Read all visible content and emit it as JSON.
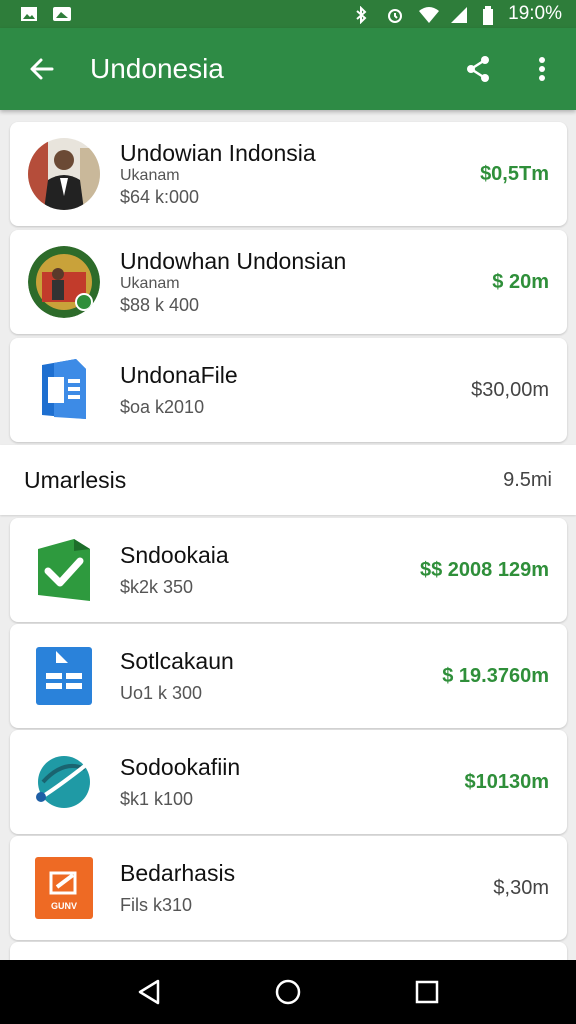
{
  "status_bar": {
    "time": "19:0%",
    "icons": [
      "image-icon",
      "photo-icon",
      "bluetooth-icon",
      "alarm-icon",
      "wifi-icon",
      "signal-icon",
      "battery-icon"
    ]
  },
  "app_bar": {
    "title": "Undonesia",
    "accent_color": "#2e8b45"
  },
  "items": [
    {
      "name": "Undowian Indonsia",
      "sub": "Ukanam",
      "meta": "$64 k:000",
      "price": "$0,5Tm",
      "price_color": "green",
      "thumb": "person-avatar"
    },
    {
      "name": "Undowhan Undonsian",
      "sub": "Ukanam",
      "meta": "$88 k 400",
      "price": "$ 20m",
      "price_color": "green",
      "thumb": "emblem-avatar"
    },
    {
      "name": "UndonaFile",
      "sub": "",
      "meta": "$oa k2010",
      "price": "$30,00m",
      "price_color": "gray",
      "thumb": "doc-app-icon"
    }
  ],
  "section": {
    "title": "Umarlesis",
    "count": "9.5mi"
  },
  "items2": [
    {
      "name": "Sndookaia",
      "meta": "$k2k 350",
      "price": "$$ 2008 129m",
      "price_color": "green",
      "thumb": "check-app-icon"
    },
    {
      "name": "Sotlcakaun",
      "meta": "Uo1 k 300",
      "price": "$ 19.3760m",
      "price_color": "green",
      "thumb": "sheet-app-icon"
    },
    {
      "name": "Sodookafiin",
      "meta": "$k1 k100",
      "price": "$10130m",
      "price_color": "green",
      "thumb": "planet-app-icon"
    },
    {
      "name": "Bedarhasis",
      "meta": "Fils k310",
      "price": "$,30m",
      "price_color": "gray",
      "thumb": "orange-app-icon",
      "thumb_text": "GUNV"
    }
  ],
  "nav_bar": {
    "icons": [
      "back-triangle-icon",
      "home-circle-icon",
      "recents-square-icon"
    ]
  }
}
